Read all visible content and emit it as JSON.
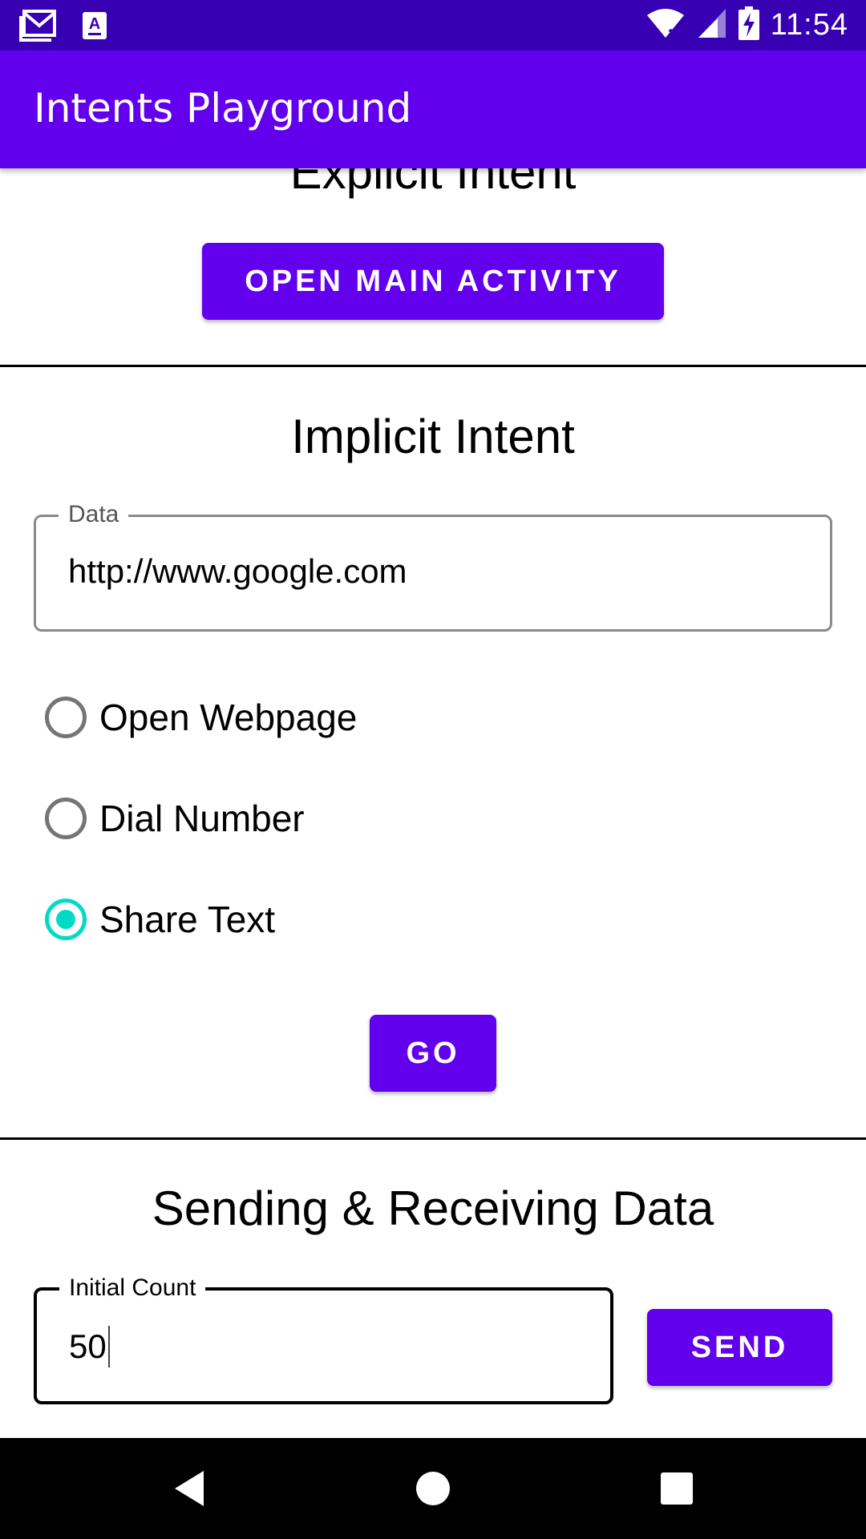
{
  "status_bar": {
    "time": "11:54",
    "icons": [
      "gmail-icon",
      "notification-a-icon",
      "wifi-icon",
      "signal-icon",
      "battery-charging-icon"
    ]
  },
  "app_bar": {
    "title": "Intents Playground"
  },
  "explicit_section": {
    "heading": "Explicit Intent",
    "button_label": "OPEN MAIN ACTIVITY"
  },
  "implicit_section": {
    "heading": "Implicit Intent",
    "data_field": {
      "label": "Data",
      "value": "http://www.google.com"
    },
    "options": [
      {
        "label": "Open Webpage",
        "selected": false
      },
      {
        "label": "Dial Number",
        "selected": false
      },
      {
        "label": "Share Text",
        "selected": true
      }
    ],
    "go_label": "GO"
  },
  "data_section": {
    "heading": "Sending & Receiving Data",
    "count_field": {
      "label": "Initial Count",
      "value": "50"
    },
    "send_label": "SEND"
  },
  "nav_bar": {
    "buttons": [
      "back-icon",
      "home-icon",
      "recents-icon"
    ]
  },
  "colors": {
    "primary": "#6200EE",
    "primary_dark": "#3700B3",
    "accent": "#03DAC5"
  }
}
